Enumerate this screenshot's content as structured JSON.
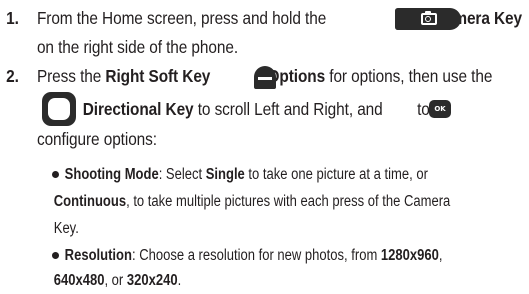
{
  "steps": [
    {
      "number": "1.",
      "line1_a": "From the Home screen, press and hold the ",
      "line1_key": "Camera Key",
      "line2": "on the right side of the phone."
    },
    {
      "number": "2.",
      "line1_a": "Press the ",
      "line1_b": "Right Soft Key",
      "line1_c": "Options",
      "line1_d": " for options, then use the",
      "line2_b": "Directional Key",
      "line2_c": " to scroll Left and Right, and ",
      "line2_d": " to",
      "line3": "configure options:"
    }
  ],
  "bullets": [
    {
      "term": "Shooting Mode",
      "l1_a": ": Select ",
      "l1_b": "Single",
      "l1_c": " to take one picture at a time, or",
      "l2_b": "Continuous",
      "l2_c": ", to take multiple pictures with each press of the Camera",
      "l3": "Key."
    },
    {
      "term": "Resolution",
      "l1_a": ": Choose a resolution for new photos, from ",
      "l1_b": "1280x960",
      "l1_c": ",",
      "l2_b": "640x480",
      "l2_c": ", or ",
      "l2_d": "320x240",
      "l2_e": "."
    }
  ],
  "icons": {
    "camera_key": "camera-key-icon",
    "right_soft_key": "right-soft-key-icon",
    "directional_key": "directional-key-icon",
    "ok_key": "ok-key-icon",
    "ok_label": "OK"
  },
  "colors": {
    "text": "#231f20",
    "key_fill": "#2b2b2b"
  }
}
